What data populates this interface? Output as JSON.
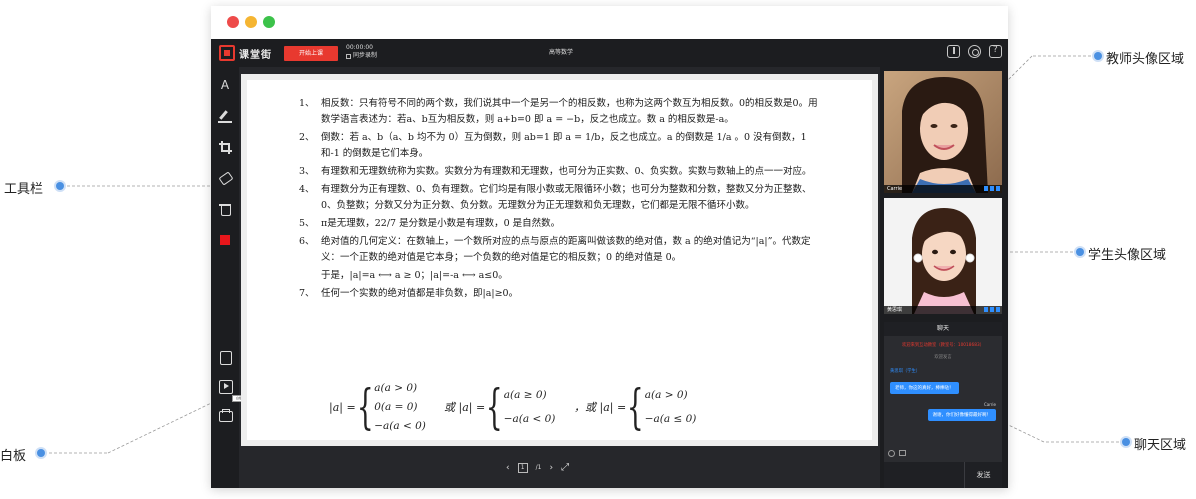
{
  "app": {
    "brand": "课堂街",
    "start_button": "开始上课",
    "timer": "00:00:00",
    "sync_label": "同步录制",
    "title": "高等数学"
  },
  "toolbar": {
    "text_tool": "A",
    "tooltip": "白板",
    "pen_color": "#e8161b"
  },
  "whiteboard": {
    "items": [
      {
        "num": "1、",
        "text": "相反数：只有符号不同的两个数，我们说其中一个是另一个的相反数，也称为这两个数互为相反数。0的相反数是0。用数学语言表述为：若a、b互为相反数，则 a+b=0 即 a = −b，反之也成立。数 a 的相反数是-a。"
      },
      {
        "num": "2、",
        "text": "倒数：若 a、b（a、b 均不为 0）互为倒数，则 ab=1 即 a = 1/b，反之也成立。a 的倒数是 1/a 。0 没有倒数，1 和-1 的倒数是它们本身。"
      },
      {
        "num": "3、",
        "text": "有理数和无理数统称为实数。实数分为有理数和无理数，也可分为正实数、0、负实数。实数与数轴上的点一一对应。"
      },
      {
        "num": "4、",
        "text": "有理数分为正有理数、0、负有理数。它们均是有限小数或无限循环小数；也可分为整数和分数，整数又分为正整数、0、负整数；分数又分为正分数、负分数。无理数分为正无理数和负无理数，它们都是无限不循环小数。"
      },
      {
        "num": "5、",
        "text": "π是无理数，22/7 是分数是小数是有理数，0 是自然数。"
      },
      {
        "num": "6、",
        "text": "绝对值的几何定义：在数轴上，一个数所对应的点与原点的距离叫做该数的绝对值，数 a 的绝对值记为“|a|”。代数定义：一个正数的绝对值是它本身；一个负数的绝对值是它的相反数；0 的绝对值是 0。"
      },
      {
        "num": "",
        "text": "于是，|a|=a ⟷ a ≥ 0；|a|=-a ⟷ a≤0。"
      },
      {
        "num": "7、",
        "text": "任何一个实数的绝对值都是非负数，即|a|≥0。"
      }
    ],
    "formula": {
      "f1_lhs": "|a| =",
      "f1_cases": [
        "a(a > 0)",
        "0(a = 0)",
        "−a(a < 0)"
      ],
      "f2_lhs": "或 |a| =",
      "f2_cases": [
        "a(a ≥ 0)",
        "−a(a < 0)"
      ],
      "f3_lhs": "，或 |a| =",
      "f3_cases": [
        "a(a > 0)",
        "−a(a ≤ 0)"
      ]
    },
    "pager": {
      "prev": "‹",
      "page": "1",
      "total": "/1",
      "next": "›"
    }
  },
  "videos": {
    "teacher_name": "Carrie",
    "student_name": "黄思琪"
  },
  "chat": {
    "title": "聊天",
    "notice": "欢迎来到互动教室（教室号：10018683）",
    "system": "欢迎发言",
    "sender": "黄思琪（学生）",
    "message_1": "老师，你这的真好，棒棒哒！",
    "sender_r": "Carrie",
    "message_2": "谢谢，你们好像懂得最好啊！",
    "send_button": "发送"
  },
  "callouts": {
    "teacher_video": "教师头像区域",
    "student_video": "学生头像区域",
    "chat_area": "聊天区域",
    "toolbar": "工具栏",
    "whiteboard": "白板"
  },
  "colors": {
    "accent": "#e8392f",
    "chat_bubble": "#2f8fff",
    "callout_dot": "#4a90e2"
  }
}
